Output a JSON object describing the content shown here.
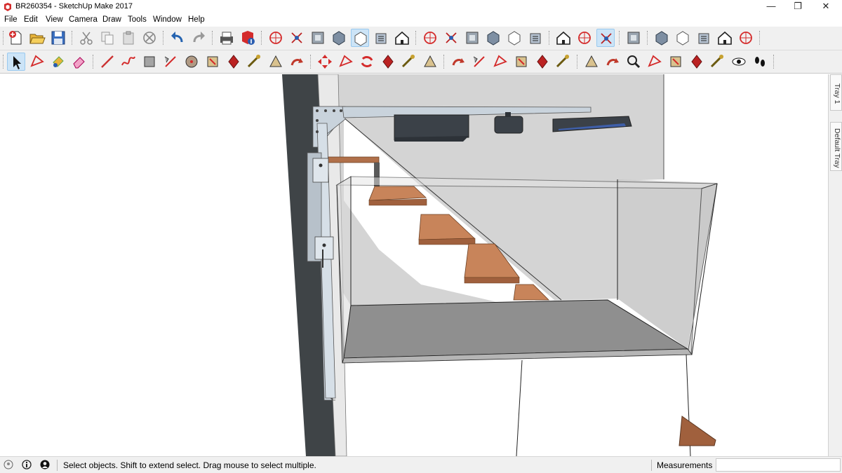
{
  "window": {
    "title": "BR260354 - SketchUp Make 2017",
    "minimize_glyph": "—",
    "restore_glyph": "❐",
    "close_glyph": "✕"
  },
  "menu": [
    "File",
    "Edit",
    "View",
    "Camera",
    "Draw",
    "Tools",
    "Window",
    "Help"
  ],
  "toolbar_top": [
    {
      "name": "new-file-icon"
    },
    {
      "name": "open-file-icon"
    },
    {
      "name": "save-icon"
    },
    {
      "name": "cut-icon"
    },
    {
      "name": "copy-icon"
    },
    {
      "name": "paste-icon"
    },
    {
      "name": "erase-selection-icon"
    },
    {
      "name": "undo-icon"
    },
    {
      "name": "redo-icon"
    },
    {
      "name": "print-icon"
    },
    {
      "name": "model-info-icon"
    },
    {
      "name": "xray-style-icon"
    },
    {
      "name": "back-edges-icon"
    },
    {
      "name": "wireframe-style-icon"
    },
    {
      "name": "hidden-line-style-icon"
    },
    {
      "name": "shaded-style-icon"
    },
    {
      "name": "shaded-textures-style-icon"
    },
    {
      "name": "monochrome-style-icon"
    },
    {
      "name": "iso-view-icon"
    },
    {
      "name": "top-view-icon"
    },
    {
      "name": "front-view-icon"
    },
    {
      "name": "right-view-icon"
    },
    {
      "name": "back-view-icon"
    },
    {
      "name": "left-view-icon"
    },
    {
      "name": "section-plane-icon"
    },
    {
      "name": "display-section-planes-icon"
    },
    {
      "name": "display-section-cuts-icon"
    },
    {
      "name": "group-icon"
    },
    {
      "name": "component-1-icon"
    },
    {
      "name": "component-2-icon"
    },
    {
      "name": "component-3-icon"
    },
    {
      "name": "component-4-icon"
    },
    {
      "name": "component-5-icon"
    }
  ],
  "toolbar_bottom": [
    {
      "name": "select-tool-icon"
    },
    {
      "name": "make-component-icon"
    },
    {
      "name": "paint-bucket-icon"
    },
    {
      "name": "eraser-icon"
    },
    {
      "name": "line-tool-icon"
    },
    {
      "name": "freehand-tool-icon"
    },
    {
      "name": "rectangle-tool-icon"
    },
    {
      "name": "rotated-rectangle-icon"
    },
    {
      "name": "circle-tool-icon"
    },
    {
      "name": "polygon-tool-icon"
    },
    {
      "name": "arc-tool-icon"
    },
    {
      "name": "two-point-arc-icon"
    },
    {
      "name": "three-point-arc-icon"
    },
    {
      "name": "pie-tool-icon"
    },
    {
      "name": "move-tool-icon"
    },
    {
      "name": "push-pull-icon"
    },
    {
      "name": "rotate-tool-icon"
    },
    {
      "name": "follow-me-icon"
    },
    {
      "name": "scale-tool-icon"
    },
    {
      "name": "offset-tool-icon"
    },
    {
      "name": "tape-measure-icon"
    },
    {
      "name": "dimension-tool-icon"
    },
    {
      "name": "protractor-icon"
    },
    {
      "name": "text-tool-icon"
    },
    {
      "name": "axes-tool-icon"
    },
    {
      "name": "3d-text-icon"
    },
    {
      "name": "orbit-tool-icon"
    },
    {
      "name": "pan-tool-icon"
    },
    {
      "name": "zoom-tool-icon"
    },
    {
      "name": "zoom-window-icon"
    },
    {
      "name": "zoom-extents-icon"
    },
    {
      "name": "previous-view-icon"
    },
    {
      "name": "position-camera-icon"
    },
    {
      "name": "look-around-icon"
    },
    {
      "name": "walk-tool-icon"
    }
  ],
  "tray": {
    "tab1": "Tray 1",
    "tab2": "Default Tray"
  },
  "status": {
    "text": "Select objects. Shift to extend select. Drag mouse to select multiple.",
    "measurements_label": "Measurements",
    "measurements_value": ""
  },
  "colors": {
    "toolbar_bg": "#f0f0f0",
    "active_tool_bg": "#cce4f7",
    "wall_dark": "#3f4447",
    "back_wall": "#d2d2d2",
    "glass": "#d9d9d9",
    "floor": "#8f8f8f",
    "wood": "#b0704a",
    "steel": "#c9d3dc"
  }
}
